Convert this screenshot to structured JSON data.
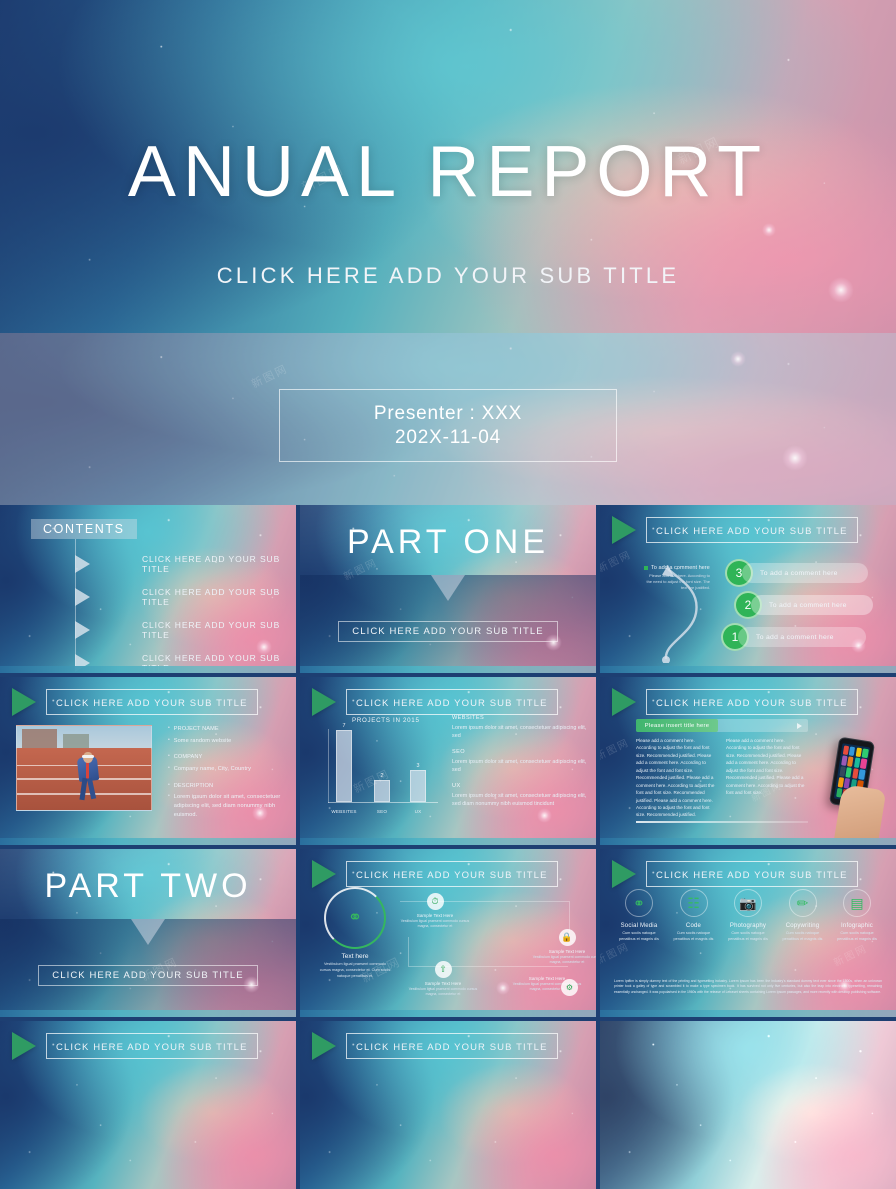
{
  "hero": {
    "title": "ANUAL REPORT",
    "subtitle": "CLICK HERE ADD YOUR SUB TITLE",
    "presenter": "Presenter : XXX",
    "date": "202X-11-04"
  },
  "common": {
    "sub_title": "CLICK HERE ADD YOUR SUB TITLE",
    "play_icon": "play-triangle-icon"
  },
  "colors": {
    "accent_green": "#2fb457",
    "deep_blue": "#1d3d72",
    "teal": "#56b3bf",
    "pink": "#d79fb2"
  },
  "slides": {
    "contents": {
      "tag": "CONTENTS",
      "items": [
        "CLICK HERE ADD YOUR SUB TITLE",
        "CLICK HERE ADD YOUR SUB TITLE",
        "CLICK HERE ADD YOUR SUB TITLE",
        "CLICK HERE ADD YOUR SUB TITLE"
      ]
    },
    "part_one": {
      "title": "PART ONE",
      "subtitle": "CLICK HERE ADD YOUR SUB TITLE"
    },
    "part_two": {
      "title": "PART TWO",
      "subtitle": "CLICK HERE ADD YOUR SUB TITLE"
    },
    "timeline": {
      "header": "CLICK HERE ADD YOUR SUB TITLE",
      "nodes": [
        {
          "number": "3",
          "label": "To add a comment here"
        },
        {
          "number": "2",
          "label": "To add a comment here"
        },
        {
          "number": "1",
          "label": "To add a comment here"
        }
      ],
      "note_heading": "To add a comment here",
      "note_body": "Please add text here. According to the need to adjust the font size. The text are justified."
    },
    "profile": {
      "header": "CLICK HERE ADD YOUR SUB TITLE",
      "photo_alt": "athlete-on-running-track",
      "bullets": [
        "PROJECT NAME",
        "Some random website",
        "COMPANY",
        "Company name, City, Country",
        "DESCRIPTION",
        "Lorem ipsum dolor sit amet, consectetuer adipiscing elit, sed diam nonummy nibh euismod."
      ]
    },
    "chart": {
      "header": "CLICK HERE ADD YOUR SUB TITLE",
      "sections": [
        {
          "heading": "WEBSITES",
          "body": "Lorem ipsum dolor sit amet, consectetuer adipiscing elit, sed"
        },
        {
          "heading": "SEO",
          "body": "Lorem ipsum dolor sit amet, consectetuer adipiscing elit, sed"
        },
        {
          "heading": "UX",
          "body": "Lorem ipsum dolor sit amet, consectetuer adipiscing elit, sed diam nonummy nibh euismod tincidunt"
        }
      ]
    },
    "phone": {
      "header": "CLICK HERE ADD YOUR SUB TITLE",
      "insert_title": "Please insert title here",
      "col_left": "Please add a comment here. According to adjust the font and font size. Recommended justified. Please add a comment here. According to adjust the font and font size. Recommended justified. Please add a comment here. According to adjust the font and font size. Recommended justified. Please add a comment here. According to adjust the font and font size. Recommended justified.",
      "col_right": "Please add a comment here. According to adjust the font and font size. Recommended justified. Please add a comment here. According to adjust the font and font size. Recommended justified. Please add a comment here. According to adjust the font and font size.",
      "device_alt": "hand-holding-smartphone"
    },
    "process": {
      "header": "CLICK HERE ADD YOUR SUB TITLE",
      "main_heading": "Text here",
      "main_body": "Vestibulum ligual praesent commodo cursus magna, consectetur et. Cum sociis natoque penatibus et.",
      "main_icon": "molecule-icon",
      "nodes": [
        {
          "icon": "clock-icon",
          "heading": "Sample Text Here",
          "body": "Vestibulum ligual praesent commodo cursus magna, consectetur et"
        },
        {
          "icon": "lock-icon",
          "heading": "Sample Text Here",
          "body": "Vestibulum ligual praesent commodo cursus magna, consectetur et"
        },
        {
          "icon": "upload-icon",
          "heading": "Sample Text Here",
          "body": "Vestibulum ligual praesent commodo cursus magna, consectetur et"
        },
        {
          "icon": "gear-icon",
          "heading": "Sample Text Here",
          "body": "Vestibulum ligual praesent commodo cursus magna, consectetur et"
        }
      ]
    },
    "icons": {
      "header": "CLICK HERE ADD YOUR SUB TITLE",
      "cells": [
        {
          "icon": "share-nodes-icon",
          "heading": "Social Media",
          "body": "Cum sociis natoque penatibus et magnis dis"
        },
        {
          "icon": "code-book-icon",
          "heading": "Code",
          "body": "Cum sociis natoque penatibus et magnis dis"
        },
        {
          "icon": "camera-icon",
          "heading": "Photography",
          "body": "Cum sociis natoque penatibus et magnis dis"
        },
        {
          "icon": "pencil-icon",
          "heading": "Copywriting",
          "body": "Cum sociis natoque penatibus et magnis dis"
        },
        {
          "icon": "chart-board-icon",
          "heading": "Infographic",
          "body": "Cum sociis natoque penatibus et magnis dis"
        }
      ],
      "footer": "Lorem Ipsum is simply dummy text of the printing and typesetting industry. Lorem Ipsum has been the industry's standard dummy text ever since the 1500s, when an unknown printer took a galley of type and scrambled it to make a type specimen book. It has survived not only five centuries, but also the leap into electronic typesetting, remaining essentially unchanged. It was popularised in the 1960s with the release of Letraset sheets containing Lorem Ipsum passages, and more recently with desktop publishing software."
    },
    "row4_left": {
      "header": "CLICK HERE ADD YOUR SUB TITLE"
    },
    "row4_mid": {
      "header": "CLICK HERE ADD YOUR SUB TITLE"
    }
  },
  "chart_data": {
    "type": "bar",
    "title": "PROJECTS IN 2015",
    "categories": [
      "WEBSITES",
      "SEO",
      "UX"
    ],
    "values": [
      7,
      2,
      3
    ],
    "xlabel": "",
    "ylabel": "",
    "ylim": [
      0,
      7.6
    ],
    "grid": false,
    "legend": "none",
    "data_labels": [
      "7",
      "2",
      "3"
    ]
  }
}
